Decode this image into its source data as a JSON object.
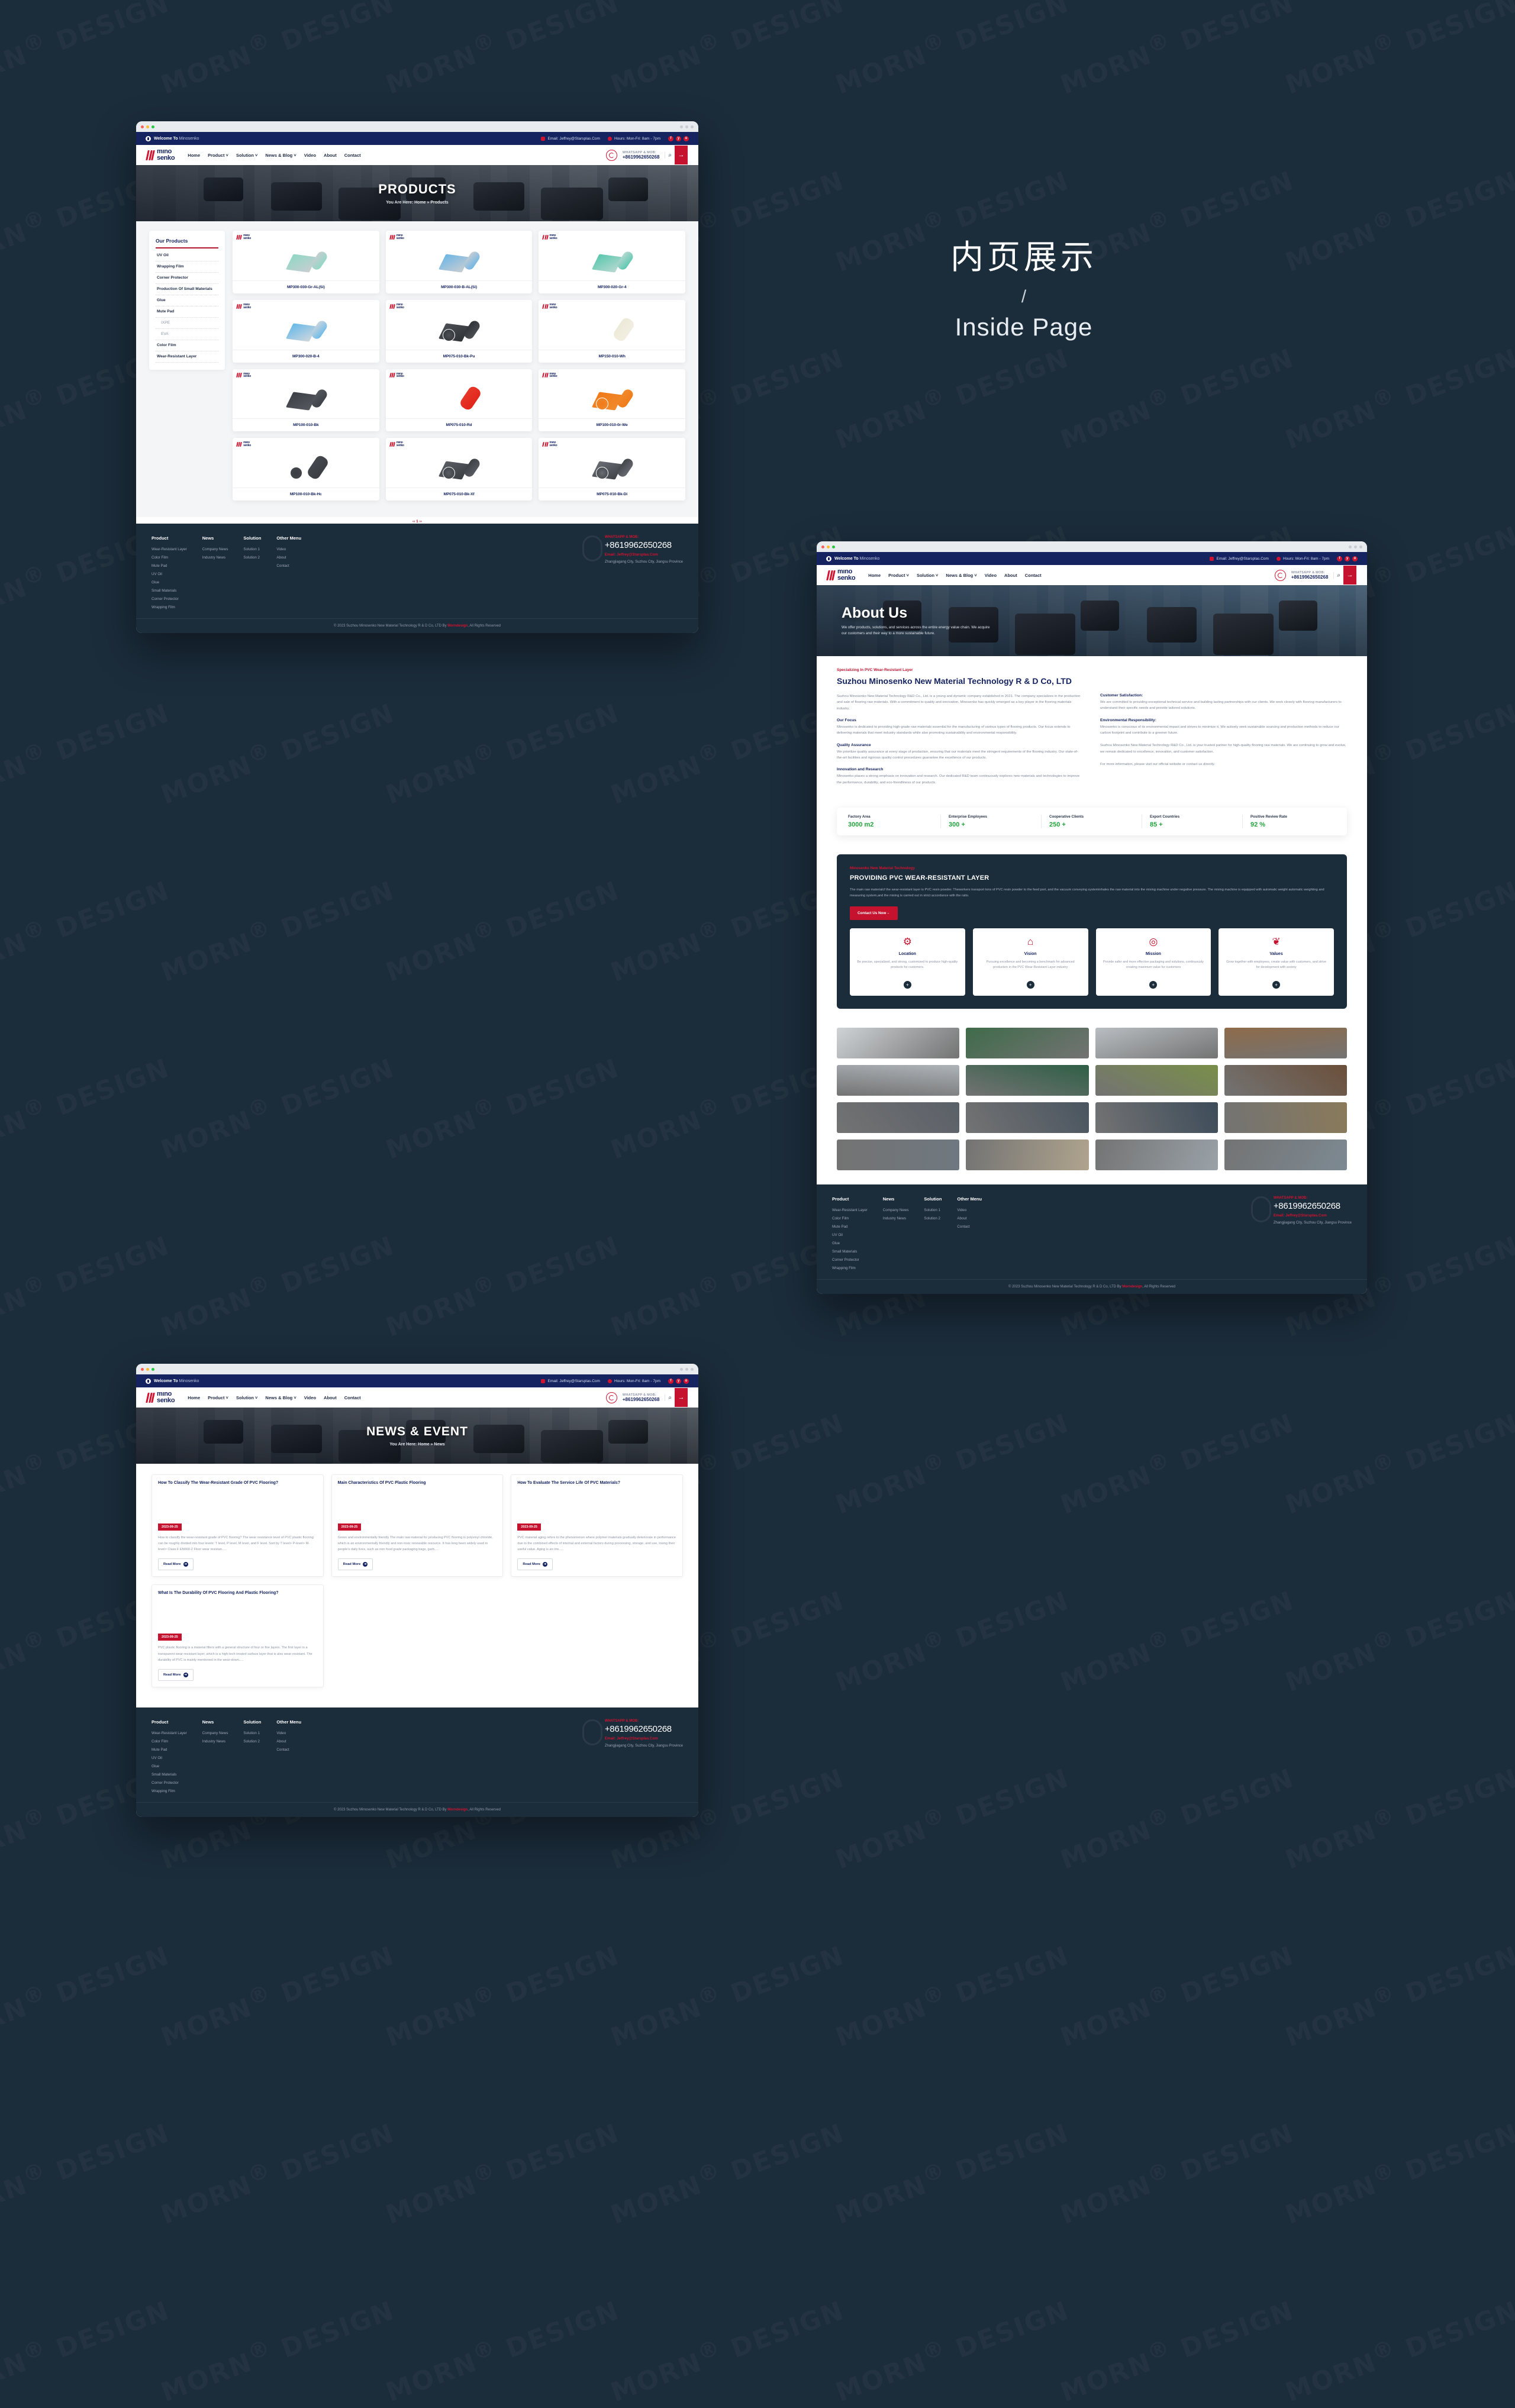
{
  "caption": {
    "cn": "内页展示",
    "slash": "/",
    "en": "Inside Page"
  },
  "topbar": {
    "welcome_bold": "Welcome To",
    "welcome_light": "Minosenko",
    "email": "Email: Jeffrey@Starsplas.Com",
    "hours": "Hours: Mon-Fri: 8am - 7pm",
    "socials": [
      "f",
      "y",
      "o"
    ]
  },
  "brand": {
    "line1": "mıno",
    "line2": "senko"
  },
  "nav": {
    "items": [
      "Home",
      "Product ˅",
      "Solution ˅",
      "News & Blog ˅",
      "Video",
      "About",
      "Contact"
    ],
    "phone_label": "WHATSAPP & MOB:",
    "phone": "+8619962650268",
    "search_icon": "⌕",
    "cta_icon": "→"
  },
  "products_page": {
    "hero_title": "PRODUCTS",
    "breadcrumb": "You Are Here: Home » Products",
    "sidebar_title": "Our Products",
    "sidebar_items": [
      {
        "label": "UV Oil",
        "sub": false
      },
      {
        "label": "Wrapping Film",
        "sub": false
      },
      {
        "label": "Corner Protector",
        "sub": false
      },
      {
        "label": "Production Of Small Materials",
        "sub": false
      },
      {
        "label": "Glue",
        "sub": false
      },
      {
        "label": "Mute Pad",
        "sub": false
      },
      {
        "label": "IXPE",
        "sub": true
      },
      {
        "label": "EVA",
        "sub": true
      },
      {
        "label": "Color Film",
        "sub": false
      },
      {
        "label": "Wear-Resistant Layer",
        "sub": false
      }
    ],
    "items": [
      {
        "name": "MP300-030-Gr-AL(Si)",
        "sheet": "#8fd8c4",
        "tube": "#c9cdd2",
        "shape": "sheet-roll",
        "circle": false
      },
      {
        "name": "MP300-030-B-AL(Si)",
        "sheet": "#6cb6e6",
        "tube": "#c9cdd2",
        "shape": "sheet-roll",
        "circle": false
      },
      {
        "name": "MP300-020-Gr-4",
        "sheet": "#57c7ad",
        "tube": "#b9d9d2",
        "shape": "sheet-roll",
        "circle": false
      },
      {
        "name": "MP300-020-B-4",
        "sheet": "#66b9ea",
        "tube": "#cfd6dd",
        "shape": "sheet-roll",
        "circle": false
      },
      {
        "name": "MP075-010-Bk-Pu",
        "sheet": "#4c4f54",
        "tube": "#2f3236",
        "shape": "sheet-roll",
        "circle": true
      },
      {
        "name": "MP150-010-Wh",
        "sheet": "#f2efe2",
        "tube": "#ede9d8",
        "shape": "big-roll",
        "circle": false
      },
      {
        "name": "MP100-010-Bk",
        "sheet": "#3c4046",
        "tube": "#55585e",
        "shape": "sheet-roll",
        "circle": false
      },
      {
        "name": "MP075-010-Rd",
        "sheet": "#e02418",
        "tube": "#e8392b",
        "shape": "big-roll",
        "circle": false
      },
      {
        "name": "MP100-010-0r-We",
        "sheet": "#f07a1a",
        "tube": "#f18b2c",
        "shape": "sheet-roll",
        "circle": true
      },
      {
        "name": "MP100-010-Bk-Hc",
        "sheet": "#3a3d42",
        "tube": "#46494f",
        "shape": "big-roll",
        "circle": true
      },
      {
        "name": "MP075-010-Bk-Xf",
        "sheet": "#5a5d63",
        "tube": "#3b3e43",
        "shape": "sheet-roll",
        "circle": true
      },
      {
        "name": "MP075-010-Bk-Di",
        "sheet": "#6a6d73",
        "tube": "#3f4247",
        "shape": "sheet-roll",
        "circle": true
      }
    ],
    "pager": "‹‹  1  ››"
  },
  "about_page": {
    "hero_title": "About Us",
    "hero_sub": "We offer products, solutions, and services across the entire energy value chain. We acquire our customers and their way to a more sustainable future.",
    "kicker": "Specializing In PVC Wear-Resistant Layer",
    "h2": "Suzhou Minosenko New Material Technology R & D Co, LTD",
    "blocks_left": [
      {
        "t": "",
        "p": "Suzhou Minosenko New Material Technology R&D Co., Ltd. is a young and dynamic company established in 2021. The company specializes in the production and sale of flooring raw materials. With a commitment to quality and innovation, Minosenko has quickly emerged as a key player in the flooring materials industry."
      },
      {
        "t": "Our Focus",
        "p": "Minosenko is dedicated to providing high-grade raw materials essential for the manufacturing of various types of flooring products. Our focus extends to delivering materials that meet industry standards while also promoting sustainability and environmental responsibility."
      },
      {
        "t": "Quality Assurance",
        "p": "We prioritize quality assurance at every stage of production, ensuring that our materials meet the stringent requirements of the flooring industry. Our state-of-the-art facilities and rigorous quality control procedures guarantee the excellence of our products."
      },
      {
        "t": "Innovation and Research",
        "p": "Minosenko places a strong emphasis on innovation and research. Our dedicated R&D team continuously explores new materials and technologies to improve the performance, durability, and eco-friendliness of our products."
      }
    ],
    "blocks_right": [
      {
        "t": "Customer Satisfaction:",
        "p": "We are committed to providing exceptional technical service and building lasting partnerships with our clients. We work closely with flooring manufacturers to understand their specific needs and provide tailored solutions."
      },
      {
        "t": "Environmental Responsibility:",
        "p": "Minosenko is conscious of its environmental impact and strives to minimize it. We actively seek sustainable sourcing and production methods to reduce our carbon footprint and contribute to a greener future."
      },
      {
        "t": "",
        "p": "Suzhou Minosenko New Material Technology R&D Co., Ltd. is your trusted partner for high-quality flooring raw materials. We are continuing to grow and evolve, we remain dedicated to excellence, innovation, and customer satisfaction."
      },
      {
        "t": "",
        "p": "For more information, please visit our official website or contact us directly."
      }
    ],
    "stats": [
      {
        "label": "Factory Area",
        "value": "3000 m2"
      },
      {
        "label": "Enterprise Employees",
        "value": "300 +"
      },
      {
        "label": "Cooperative Clients",
        "value": "250 +"
      },
      {
        "label": "Export Countries",
        "value": "85 +"
      },
      {
        "label": "Positive Review Rate",
        "value": "92 %"
      }
    ],
    "dark": {
      "kicker": "Minosenko New Material Technology",
      "h3": "PROVIDING PVC WEAR-RESISTANT LAYER",
      "p": "The main raw materialcf the wear-resistant layer is PVC resin powder. Theworkers transport tons of PVC resin powder to the feed port, and the vacuum conveying systeminhales the raw material into the mixing machine under negative pressure. The mixing machine is equipped with automatic weight automatic weighting and measuring system,and the mixing is carried out in strict accordance with the ratio.",
      "button": "Contact Us Now→",
      "cards": [
        {
          "icon": "⚙",
          "title": "Location",
          "text": "Be precise, specialized, and strong, customized to produce high-quality products for customers.",
          "plus": "+"
        },
        {
          "icon": "⌂",
          "title": "Vision",
          "text": "Pursuing excellence and becoming a benchmark for advanced production in the PVC Wear-Resistant Layer industry",
          "plus": "+"
        },
        {
          "icon": "◎",
          "title": "Mission",
          "text": "Provide safer and more effective packaging and solutions, continuously creating maximum value for customers",
          "plus": "+"
        },
        {
          "icon": "❦",
          "title": "Values",
          "text": "Grow together with employees, create value with customers, and strive for development with society",
          "plus": "+"
        }
      ]
    },
    "gallery": [
      "#cfd3d6",
      "#3f6b4a",
      "#b9bec2",
      "#8e6b4a",
      "#aeb4b9",
      "#2f5f46",
      "#7a8f4a",
      "#6b4f3a",
      "#5a6068",
      "#4a5560",
      "#3d4c5a",
      "#8a7a5a",
      "#6f7880",
      "#b0a48e",
      "#9aa2a8",
      "#7d8a93"
    ]
  },
  "news_page": {
    "hero_title": "NEWS & EVENT",
    "breadcrumb": "You Are Here: Home » News",
    "read_more": "Read More",
    "read_more_icon": "➜",
    "items": [
      {
        "title": "How To Classify The Wear-Resistant Grade Of PVC Flooring?",
        "date": "2023-09-25",
        "img": "#d8cfc2",
        "excerpt": "How to classify the wear-resistant grade of PVC flooring? The wear resistance level of PVC plastic flooring can be roughly divided into four levels: T level, P level, M level, and F level. Sort by T level> P-level> M-level> Class F EN660-2 Floor wear resistan....."
      },
      {
        "title": "Main Characteristics Of PVC Plastic Flooring",
        "date": "2023-09-25",
        "img": "#c4bdb6",
        "excerpt": "Green and environmentally friendly The main raw material for producing PVC flooring is polyvinyl chloride, which is an environmentally friendly and non-toxic renewable resource. It has long been widely used in people's daily lives, such as non food grade packaging bags, garb....."
      },
      {
        "title": "How To Evaluate The Service Life Of PVC Materials?",
        "date": "2023-09-25",
        "img": "#d3c3ab",
        "excerpt": "PVC material aging refers to the phenomenon where polymer materials gradually deteriorate in performance due to the combined effects of internal and external factors during processing, storage, and use, losing their useful value. Aging is an irre....."
      },
      {
        "title": "What Is The Durability Of PVC Flooring And Plastic Flooring?",
        "date": "2023-09-25",
        "img": "#c9c2b8",
        "excerpt": "PVC plastic flooring is a material fillers with a general structure of four or five layers. The first layer is a transparent wear-resistant layer, which is a high-tech treated surface layer that is also wear-resistant. The durability of PVC is mainly mentioned in the wear-down....."
      }
    ]
  },
  "footer": {
    "columns": [
      {
        "title": "Product",
        "links": [
          "Wear-Resistant Layer",
          "Color Film",
          "Mute Pad",
          "UV Oil",
          "Glue",
          "Small Materials",
          "Corner Protector",
          "Wrapping Film"
        ]
      },
      {
        "title": "News",
        "links": [
          "Company News",
          "Industry News"
        ]
      },
      {
        "title": "Solution",
        "links": [
          "Solution 1",
          "Solution 2"
        ]
      },
      {
        "title": "Other Menu",
        "links": [
          "Video",
          "About",
          "Contact"
        ]
      }
    ],
    "contact_label": "WHATSAPP & MOB:",
    "phone": "+8619962650268",
    "email": "Email: Jeffrey@Starsplas.Com",
    "address": "Zhangjiagang City, Suzhou City, Jiangsu Province",
    "copyright_pre": "© 2023 Suzhou Minosenko New Material Technology R & D Co, LTD By ",
    "copyright_link": "Morndesign",
    "copyright_post": ", All Rights Reserved"
  },
  "colors": {
    "brand_red": "#c4122f",
    "navy": "#152461",
    "dark": "#1b2c3b",
    "green": "#23a33d"
  }
}
